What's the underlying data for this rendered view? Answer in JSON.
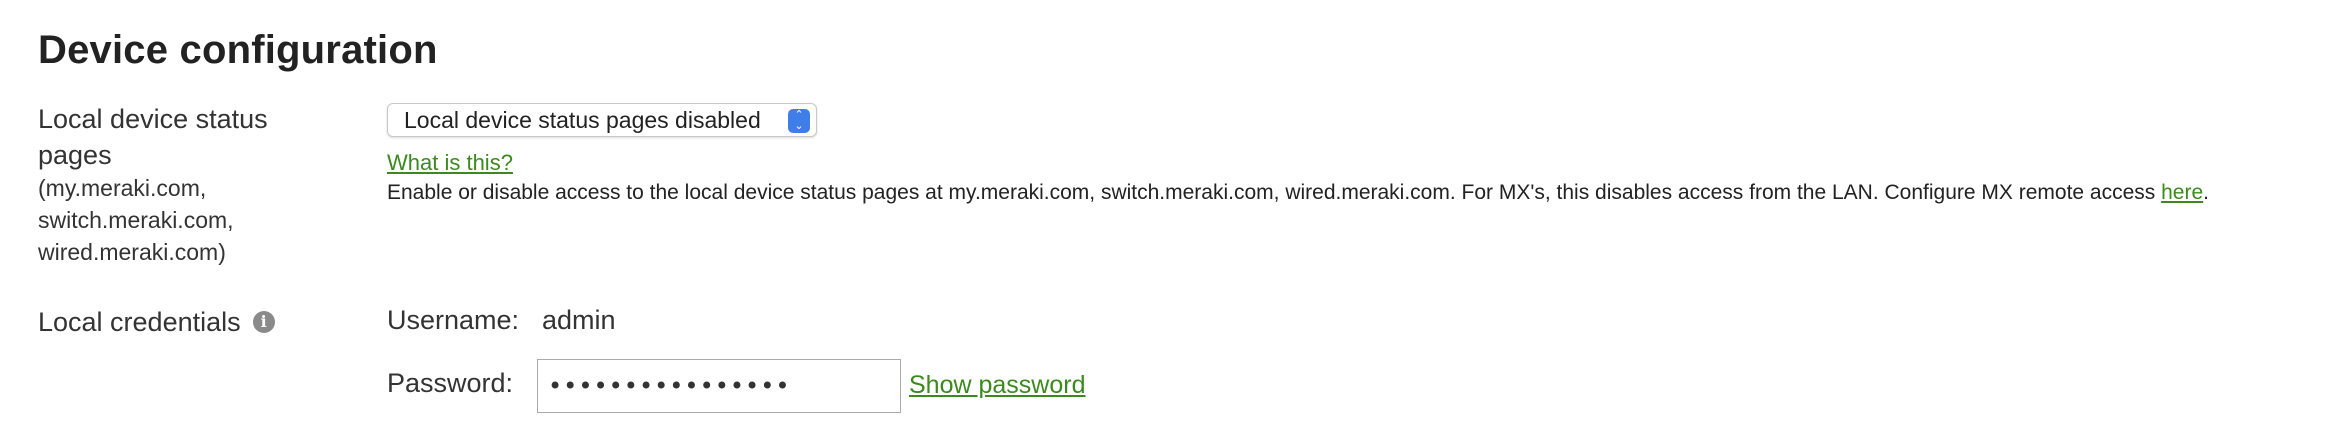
{
  "section": {
    "title": "Device configuration"
  },
  "status_pages": {
    "label": "Local device status pages",
    "sublabel": "(my.meraki.com, switch.meraki.com, wired.meraki.com)",
    "select_value": "Local device status pages disabled",
    "what_link": "What is this?",
    "description_text": "Enable or disable access to the local device status pages at my.meraki.com, switch.meraki.com, wired.meraki.com. For MX's, this disables access from the LAN. Configure MX remote access ",
    "description_link": "here",
    "description_end": "."
  },
  "credentials": {
    "label": "Local credentials",
    "info_icon": "info-icon",
    "username_label": "Username:",
    "username_value": "admin",
    "password_label": "Password:",
    "password_value": "••••••••••••••••",
    "show_password_link": "Show password"
  },
  "colors": {
    "link": "#3c8a1e",
    "select_accent": "#3f7ee8"
  }
}
